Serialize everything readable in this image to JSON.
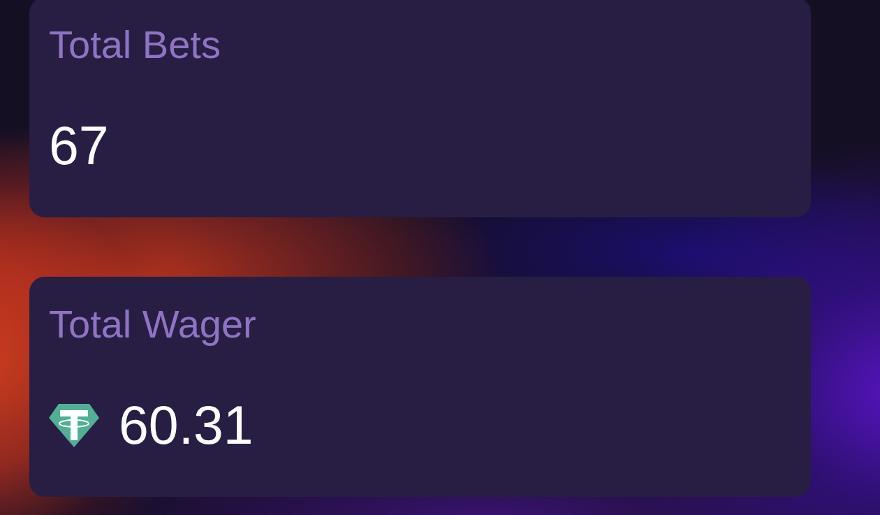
{
  "stats": [
    {
      "kind": "count",
      "label": "Total Bets",
      "value": "67"
    },
    {
      "kind": "currency",
      "label": "Total Wager",
      "value": "60.31"
    }
  ]
}
